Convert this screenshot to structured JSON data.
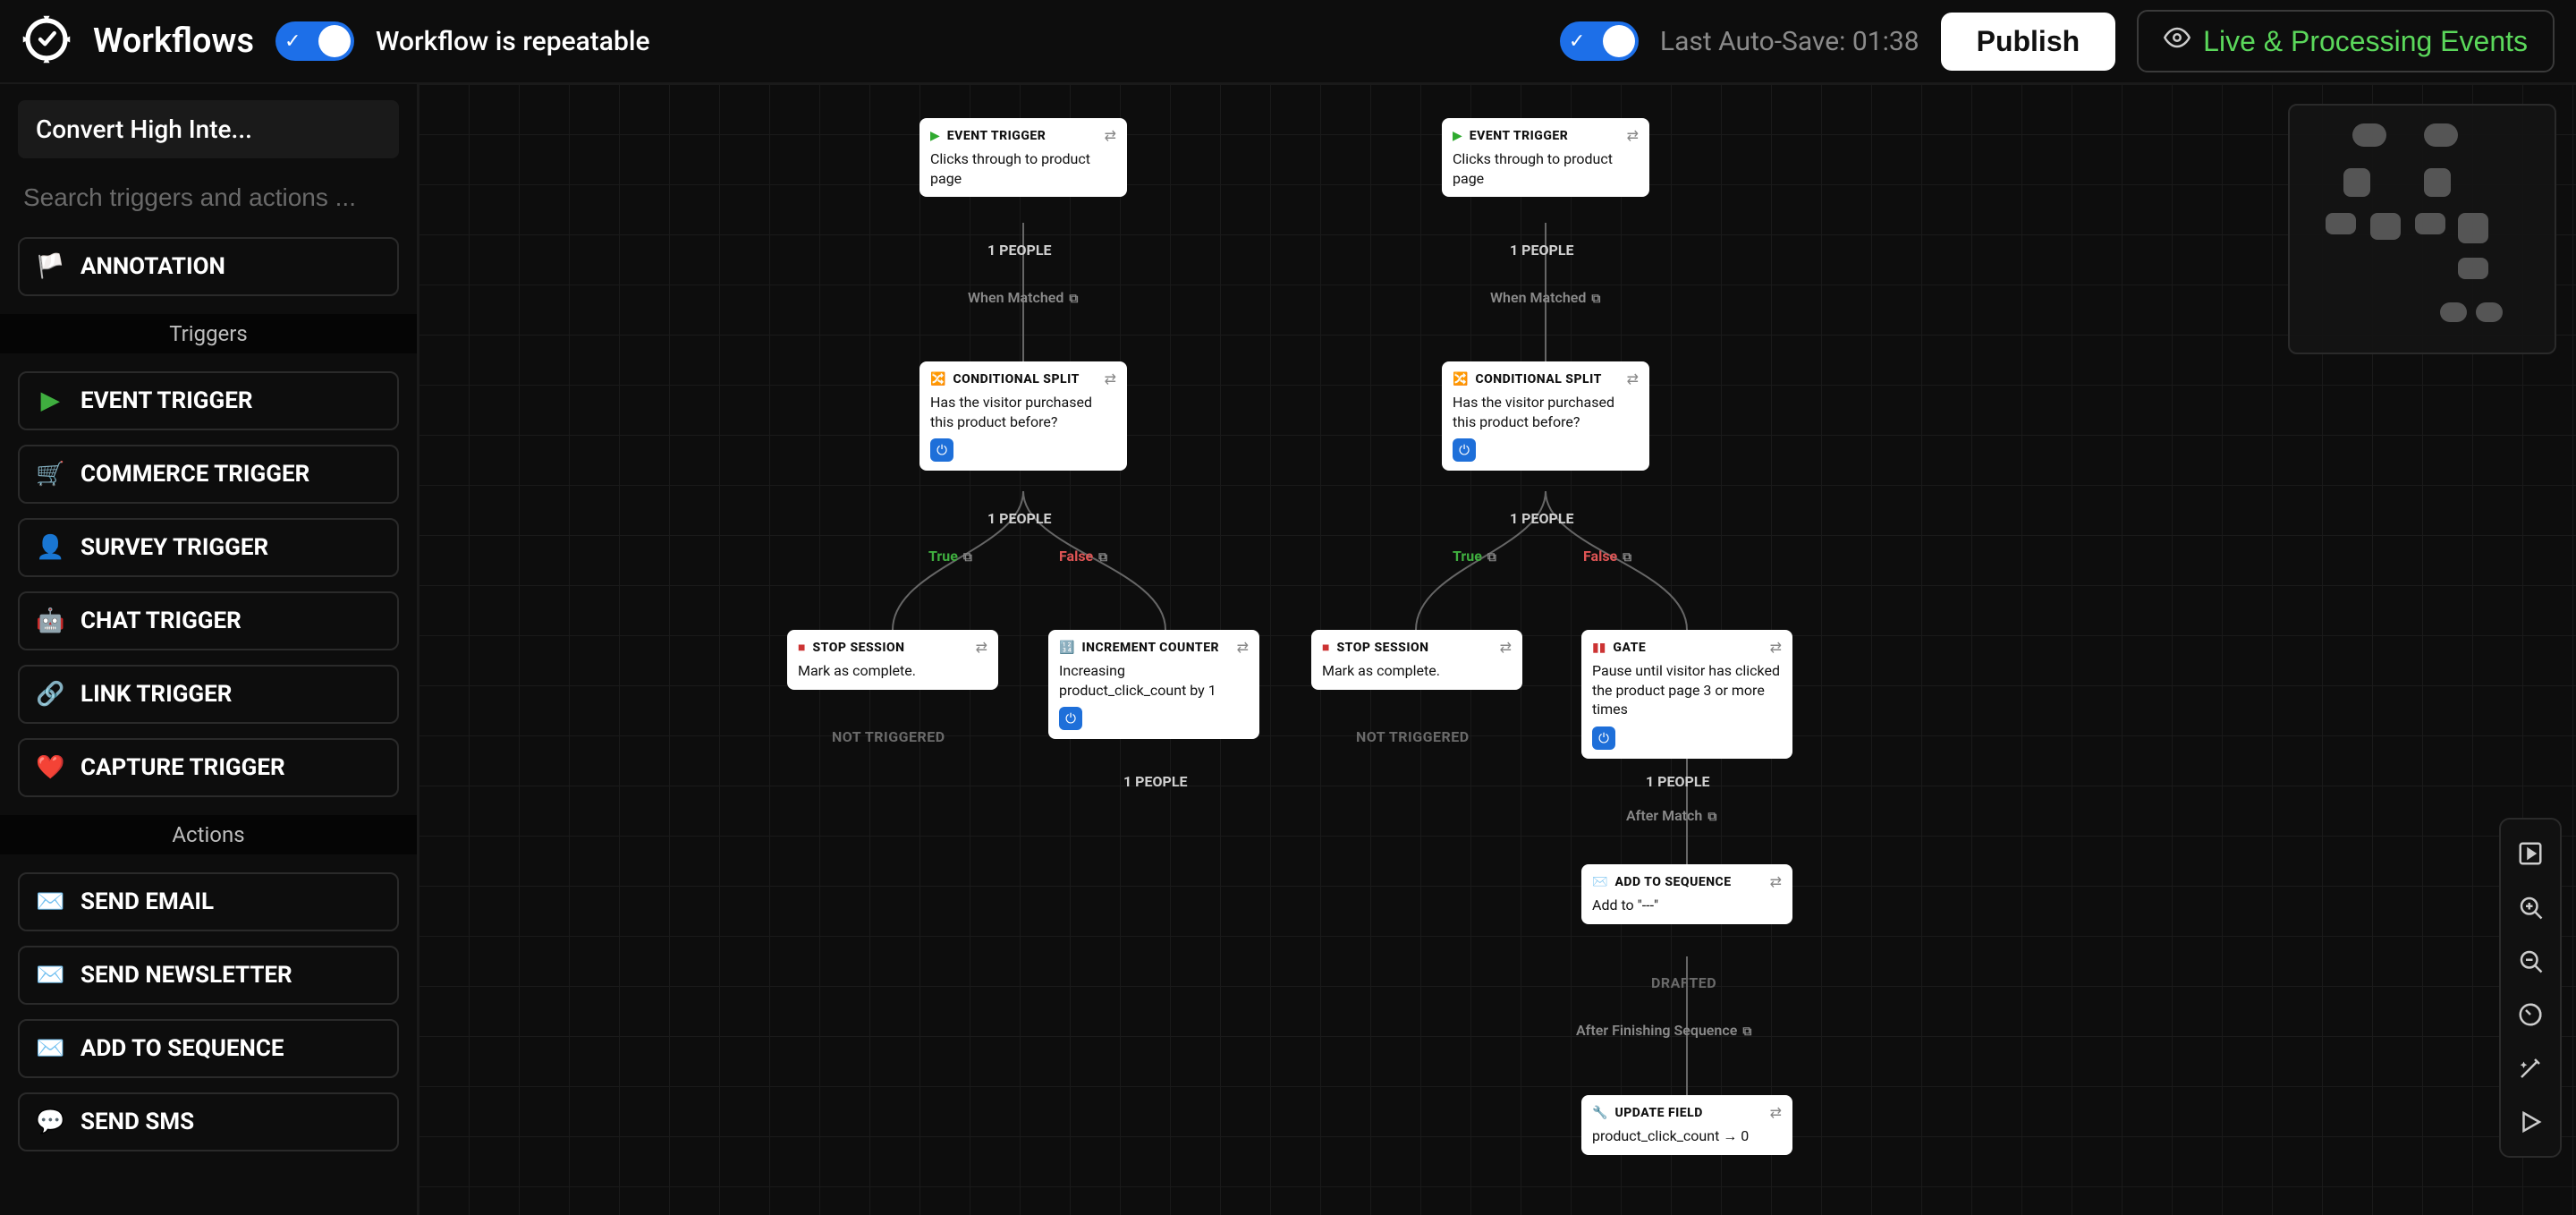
{
  "header": {
    "app_title": "Workflows",
    "repeatable_label": "Workflow is repeatable",
    "autosave_label": "Last Auto-Save: 01:38",
    "publish_label": "Publish",
    "live_label": "Live & Processing Events"
  },
  "sidebar": {
    "workflow_name": "Convert High Inte...",
    "search_placeholder": "Search triggers and actions ...",
    "annotation_label": "ANNOTATION",
    "triggers_header": "Triggers",
    "actions_header": "Actions",
    "triggers": [
      {
        "icon": "▶",
        "label": "EVENT TRIGGER",
        "name": "event-trigger"
      },
      {
        "icon": "🛒",
        "label": "COMMERCE TRIGGER",
        "name": "commerce-trigger"
      },
      {
        "icon": "👤",
        "label": "SURVEY TRIGGER",
        "name": "survey-trigger"
      },
      {
        "icon": "🤖",
        "label": "CHAT TRIGGER",
        "name": "chat-trigger"
      },
      {
        "icon": "🔗",
        "label": "LINK TRIGGER",
        "name": "link-trigger"
      },
      {
        "icon": "❤️",
        "label": "CAPTURE TRIGGER",
        "name": "capture-trigger"
      }
    ],
    "actions": [
      {
        "icon": "✉️",
        "label": "SEND EMAIL",
        "name": "send-email"
      },
      {
        "icon": "✉️",
        "label": "SEND NEWSLETTER",
        "name": "send-newsletter"
      },
      {
        "icon": "✉️",
        "label": "ADD TO SEQUENCE",
        "name": "add-to-sequence"
      },
      {
        "icon": "💬",
        "label": "SEND SMS",
        "name": "send-sms"
      }
    ]
  },
  "canvas": {
    "labels": {
      "one_people": "1 PEOPLE",
      "when_matched": "When Matched",
      "true": "True",
      "false": "False",
      "not_triggered": "NOT TRIGGERED",
      "drafted": "DRAFTED",
      "after_match": "After Match",
      "after_finishing": "After Finishing Sequence"
    },
    "node_types": {
      "event_trigger": "EVENT TRIGGER",
      "conditional_split": "CONDITIONAL SPLIT",
      "stop_session": "STOP SESSION",
      "increment_counter": "INCREMENT COUNTER",
      "gate": "GATE",
      "add_to_sequence": "ADD TO SEQUENCE",
      "update_field": "UPDATE FIELD"
    },
    "nodes": {
      "a_trigger": "Clicks through to product page",
      "a_split": "Has the visitor purchased this product before?",
      "a_stop": "Mark as complete.",
      "a_inc": "Increasing product_click_count by 1",
      "b_trigger": "Clicks through to product page",
      "b_split": "Has the visitor purchased this product before?",
      "b_stop": "Mark as complete.",
      "b_gate": "Pause until visitor has clicked the product page 3 or more times",
      "b_seq": "Add to \"---\"",
      "b_update": "product_click_count → 0"
    }
  }
}
